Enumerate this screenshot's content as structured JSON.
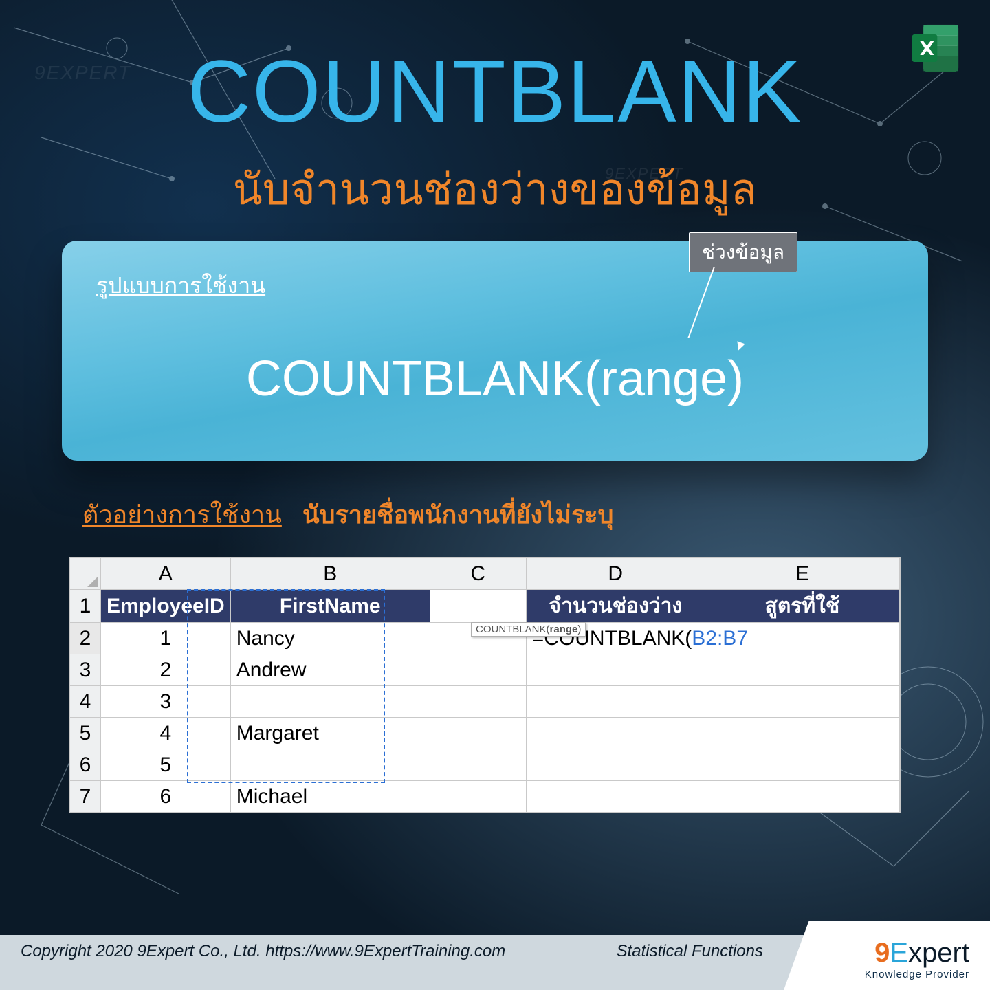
{
  "watermark": "9EXPERT",
  "title": "COUNTBLANK",
  "subtitle": "นับจำนวนช่องว่างของข้อมูล",
  "syntax": {
    "label": "รูปแบบการใช้งาน",
    "formula": "COUNTBLANK(range)",
    "arg_desc": "ช่วงข้อมูล"
  },
  "example": {
    "label": "ตัวอย่างการใช้งาน",
    "desc": "นับรายชื่อพนักงานที่ยังไม่ระบุ"
  },
  "sheet": {
    "cols": [
      "A",
      "B",
      "C",
      "D",
      "E"
    ],
    "rowNums": [
      "1",
      "2",
      "3",
      "4",
      "5",
      "6",
      "7"
    ],
    "headers": [
      "EmployeeID",
      "FirstName",
      "จำนวนช่องว่าง",
      "สูตรที่ใช้"
    ],
    "rows": [
      {
        "id": "1",
        "name": "Nancy"
      },
      {
        "id": "2",
        "name": "Andrew"
      },
      {
        "id": "3",
        "name": ""
      },
      {
        "id": "4",
        "name": "Margaret"
      },
      {
        "id": "5",
        "name": ""
      },
      {
        "id": "6",
        "name": "Michael"
      }
    ],
    "formula": {
      "prefix": "=COUNTBLANK(",
      "range": "B2:B7"
    },
    "tooltip": {
      "func": "COUNTBLANK",
      "arg": "range"
    }
  },
  "footer": {
    "copyright": "Copyright 2020 9Expert Co., Ltd.   https://www.9ExpertTraining.com",
    "category": "Statistical Functions",
    "brand": {
      "nine": "9",
      "e": "E",
      "rest": "xpert",
      "tagline": "Knowledge Provider"
    }
  }
}
